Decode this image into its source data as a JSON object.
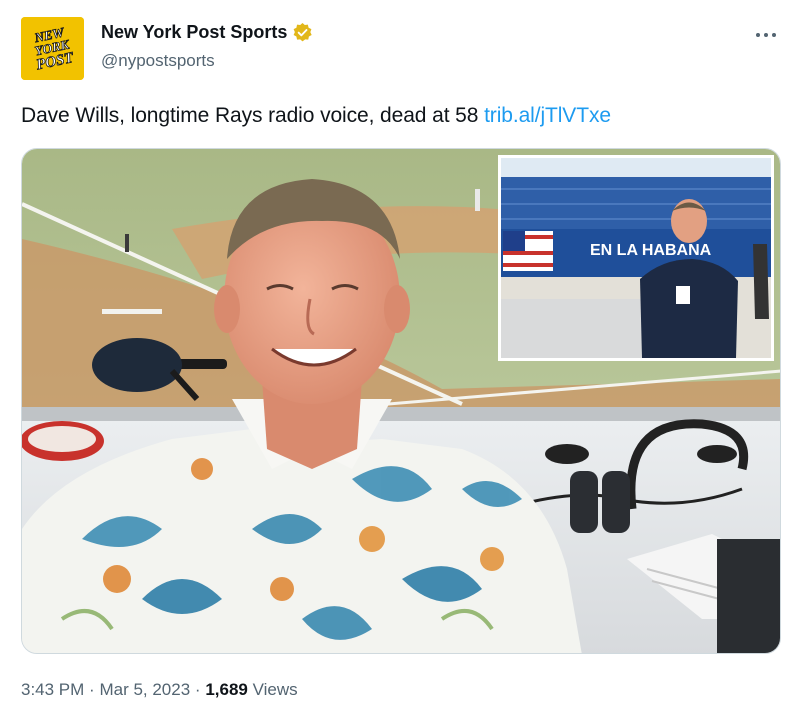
{
  "author": {
    "display_name": "New York Post Sports",
    "handle": "@nypostsports",
    "avatar_text": [
      "NEW",
      "YORK",
      "POST"
    ]
  },
  "tweet": {
    "text": "Dave Wills, longtime Rays radio voice, dead at 58 ",
    "link_text": "trib.al/jTlVTxe"
  },
  "media": {
    "inset_sign_text": "EN LA HABANA"
  },
  "meta": {
    "time": "3:43 PM",
    "date": "Mar 5, 2023",
    "separator": "·",
    "views_count": "1,689",
    "views_label": "Views"
  },
  "colors": {
    "link": "#1d9bf0",
    "secondary_text": "#536471",
    "verified_badge": "#e2b719",
    "avatar_bg": "#f2c200"
  },
  "icons": {
    "verified": "verified-badge-icon",
    "more": "more-options-icon"
  }
}
